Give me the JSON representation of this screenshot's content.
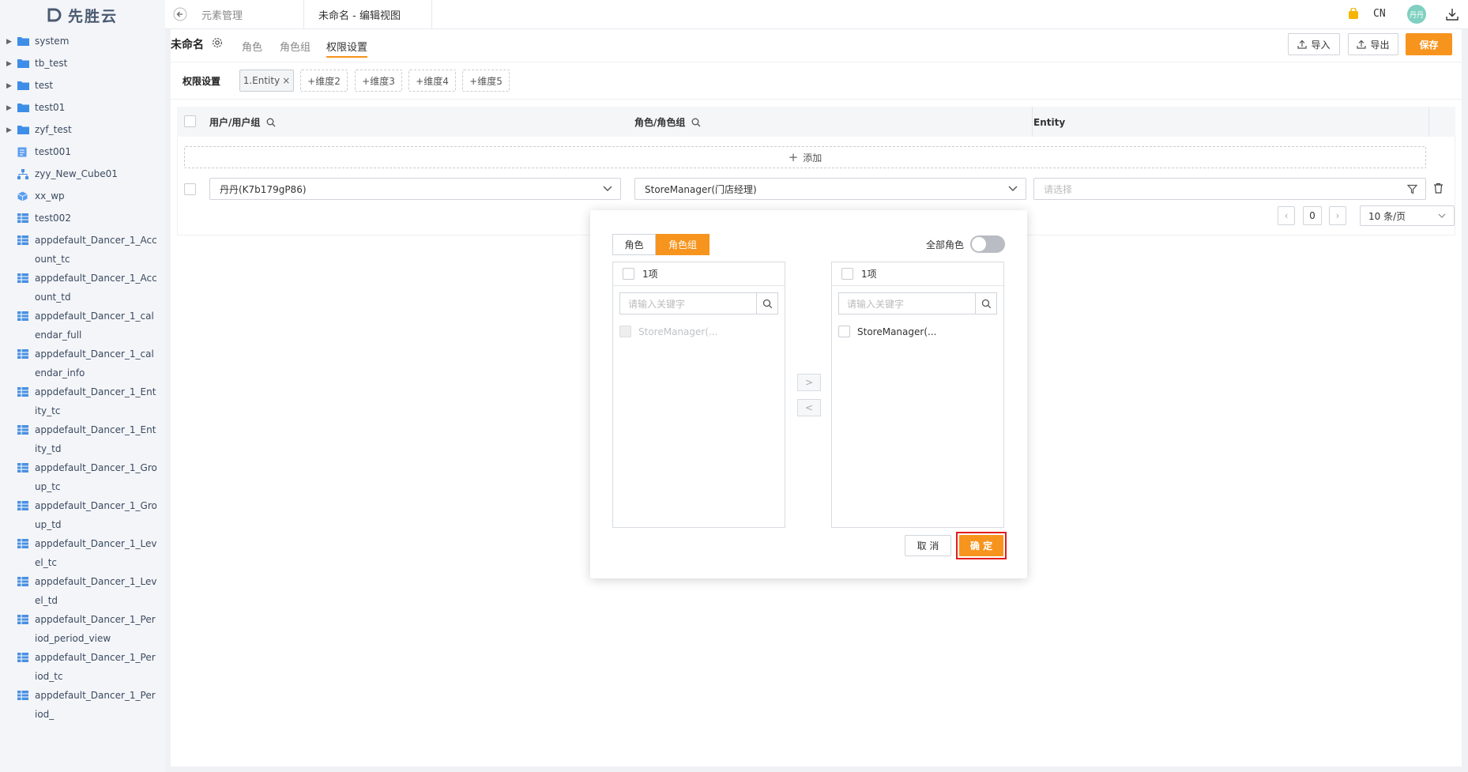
{
  "app": {
    "logo": "先胜云"
  },
  "sidebar": {
    "items": [
      {
        "label": "system",
        "icon": "folder-icon",
        "expandable": true
      },
      {
        "label": "tb_test",
        "icon": "folder-icon",
        "expandable": true
      },
      {
        "label": "test",
        "icon": "folder-icon",
        "expandable": true
      },
      {
        "label": "test01",
        "icon": "folder-icon",
        "expandable": true
      },
      {
        "label": "zyf_test",
        "icon": "folder-icon",
        "expandable": true
      },
      {
        "label": "test001",
        "icon": "document-icon",
        "expandable": false
      },
      {
        "label": "zyy_New_Cube01",
        "icon": "hierarchy-icon",
        "expandable": false
      },
      {
        "label": "xx_wp",
        "icon": "cube-icon",
        "expandable": false
      },
      {
        "label": "test002",
        "icon": "table-icon",
        "expandable": false
      },
      {
        "label": "appdefault_Dancer_1_Account_tc",
        "icon": "table-icon",
        "expandable": false
      },
      {
        "label": "appdefault_Dancer_1_Account_td",
        "icon": "table-icon",
        "expandable": false
      },
      {
        "label": "appdefault_Dancer_1_calendar_full",
        "icon": "table-icon",
        "expandable": false
      },
      {
        "label": "appdefault_Dancer_1_calendar_info",
        "icon": "table-icon",
        "expandable": false
      },
      {
        "label": "appdefault_Dancer_1_Entity_tc",
        "icon": "table-icon",
        "expandable": false
      },
      {
        "label": "appdefault_Dancer_1_Entity_td",
        "icon": "table-icon",
        "expandable": false
      },
      {
        "label": "appdefault_Dancer_1_Group_tc",
        "icon": "table-icon",
        "expandable": false
      },
      {
        "label": "appdefault_Dancer_1_Group_td",
        "icon": "table-icon",
        "expandable": false
      },
      {
        "label": "appdefault_Dancer_1_Level_tc",
        "icon": "table-icon",
        "expandable": false
      },
      {
        "label": "appdefault_Dancer_1_Level_td",
        "icon": "table-icon",
        "expandable": false
      },
      {
        "label": "appdefault_Dancer_1_Period_period_view",
        "icon": "table-icon",
        "expandable": false
      },
      {
        "label": "appdefault_Dancer_1_Period_tc",
        "icon": "table-icon",
        "expandable": false
      },
      {
        "label": "appdefault_Dancer_1_Period_",
        "icon": "table-icon",
        "expandable": false
      }
    ]
  },
  "topbar": {
    "tabs": [
      {
        "label": "元素管理",
        "active": false
      },
      {
        "label": "未命名 - 编辑视图",
        "active": true
      }
    ],
    "lang": "CN",
    "avatar": "丹丹"
  },
  "header": {
    "title": "未命名",
    "subtabs": [
      {
        "label": "角色",
        "active": false
      },
      {
        "label": "角色组",
        "active": false
      },
      {
        "label": "权限设置",
        "active": true
      }
    ],
    "import_label": "导入",
    "export_label": "导出",
    "save_label": "保存"
  },
  "dimensions": {
    "label": "权限设置",
    "tags": [
      "1.Entity",
      "+维度2",
      "+维度3",
      "+维度4",
      "+维度5"
    ]
  },
  "table": {
    "columns": [
      "用户/用户组",
      "角色/角色组",
      "Entity"
    ],
    "add_label": "添加",
    "rows": [
      {
        "user": "丹丹(K7b179gP86)",
        "role": "StoreManager(门店经理)",
        "entity_placeholder": "请选择"
      }
    ]
  },
  "pagination": {
    "page": "0",
    "page_size": "10 条/页"
  },
  "popup": {
    "toggle_tabs": [
      {
        "label": "角色",
        "active": false
      },
      {
        "label": "角色组",
        "active": true
      }
    ],
    "all_roles_label": "全部角色",
    "all_roles_on": false,
    "left": {
      "count": "1项",
      "search_placeholder": "请输入关键字",
      "items": [
        {
          "label": "StoreManager(...",
          "disabled": true
        }
      ]
    },
    "right": {
      "count": "1项",
      "search_placeholder": "请输入关键字",
      "items": [
        {
          "label": "StoreManager(...",
          "disabled": false
        }
      ]
    },
    "cancel_label": "取 消",
    "confirm_label": "确 定"
  },
  "colors": {
    "accent": "#f7941d",
    "highlight": "#e21c1c",
    "folder": "#3d8ee8"
  }
}
